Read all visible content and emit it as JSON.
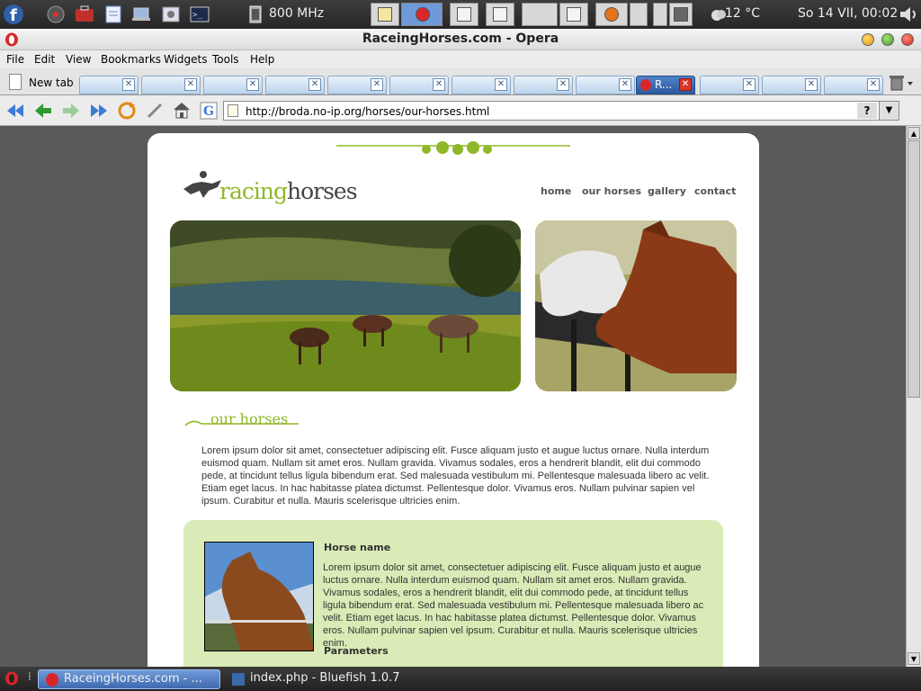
{
  "panel": {
    "cpu": "800 MHz",
    "weather": "12 °C",
    "clock": "So 14 VII, 00:02"
  },
  "window": {
    "title": "RaceingHorses.com - Opera"
  },
  "menu": [
    "File",
    "Edit",
    "View",
    "Bookmarks",
    "Widgets",
    "Tools",
    "Help"
  ],
  "tabs": {
    "new_tab_label": "New tab",
    "active_tab_label": "R..."
  },
  "address": {
    "url": "http://broda.no-ip.org/horses/our-horses.html",
    "help_label": "?"
  },
  "site": {
    "logo_racing": "racing",
    "logo_horses": "horses",
    "nav": [
      "home",
      "our horses",
      "gallery",
      "contact"
    ],
    "section_title": "our horses",
    "intro": "Lorem ipsum dolor sit amet, consectetuer adipiscing elit. Fusce aliquam justo et augue luctus ornare. Nulla interdum euismod quam. Nullam sit amet eros. Nullam gravida. Vivamus sodales, eros a hendrerit blandit, elit dui commodo pede, at tincidunt tellus ligula bibendum erat. Sed malesuada vestibulum mi. Pellentesque malesuada libero ac velit. Etiam eget lacus. In hac habitasse platea dictumst. Pellentesque dolor. Vivamus eros. Nullam pulvinar sapien vel ipsum. Curabitur et nulla. Mauris scelerisque ultricies enim.",
    "card": {
      "name": "Horse name",
      "text": "Lorem ipsum dolor sit amet, consectetuer adipiscing elit. Fusce aliquam justo et augue luctus ornare. Nulla interdum euismod quam. Nullam sit amet eros. Nullam gravida. Vivamus sodales, eros a hendrerit blandit, elit dui commodo pede, at tincidunt tellus ligula bibendum erat. Sed malesuada vestibulum mi. Pellentesque malesuada libero ac velit. Etiam eget lacus. In hac habitasse platea dictumst. Pellentesque dolor. Vivamus eros. Nullam pulvinar sapien vel ipsum. Curabitur et nulla. Mauris scelerisque ultricies enim.",
      "params_heading": "Parameters"
    }
  },
  "taskbar": {
    "items": [
      "RaceingHorses.com - ...",
      "index.php - Bluefish 1.0.7"
    ]
  },
  "colors": {
    "accent_green": "#8fb829",
    "card_bg": "#d9ebb6",
    "active_tab": "#3f6ab0"
  }
}
